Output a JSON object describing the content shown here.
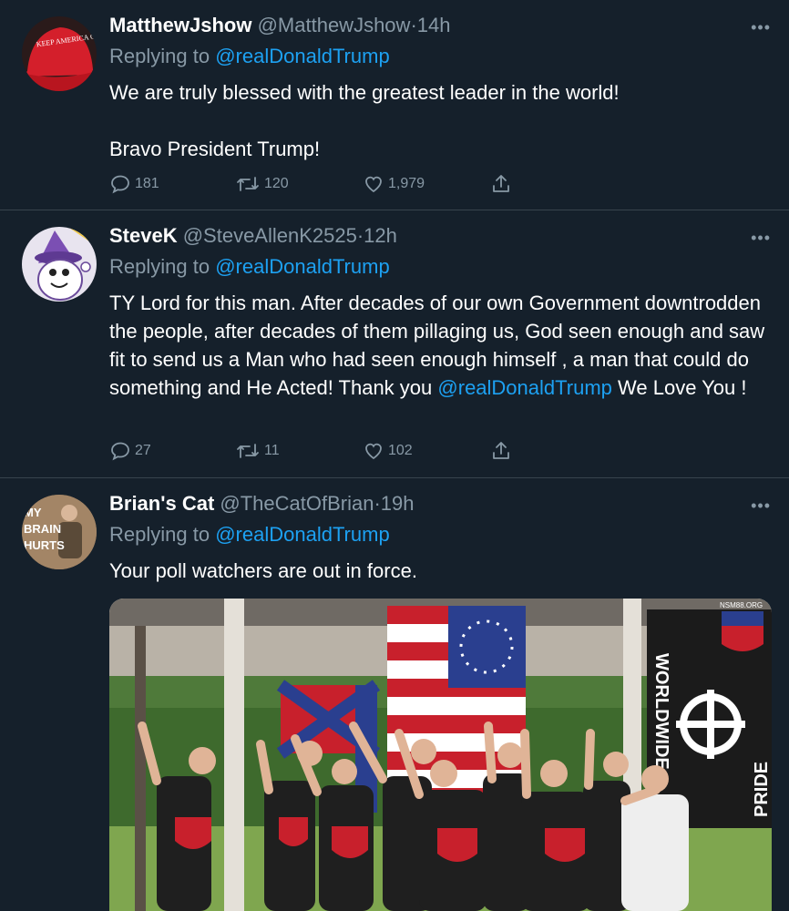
{
  "tweets": [
    {
      "name": "MatthewJshow",
      "handle": "@MatthewJshow",
      "dot": "·",
      "time": "14h",
      "replying_prefix": "Replying to",
      "replying_to": "@realDonaldTrump",
      "text_line1": "We are truly blessed with the greatest leader in the world!",
      "text_line2": "Bravo President Trump!",
      "replies": "181",
      "retweets": "120",
      "likes": "1,979",
      "avatar_text": "KEEP AMERICA GREAT"
    },
    {
      "name": "SteveK",
      "handle": "@SteveAllenK2525",
      "dot": "·",
      "time": "12h",
      "replying_prefix": "Replying to",
      "replying_to": "@realDonaldTrump",
      "text": "TY Lord for this man. After decades of our own Government downtrodden the people, after decades of them pillaging us, God seen enough and saw fit to send us a Man who had seen enough himself , a man that could do something and He Acted! Thank you",
      "text_mention": "@realDonaldTrump",
      "text_end": " We Love You !",
      "replies": "27",
      "retweets": "11",
      "likes": "102"
    },
    {
      "name": "Brian's Cat",
      "handle": "@TheCatOfBrian",
      "dot": "·",
      "time": "19h",
      "replying_prefix": "Replying to",
      "replying_to": "@realDonaldTrump",
      "text": "Your poll watchers are out in force.",
      "avatar_text_1": "MY",
      "avatar_text_2": "BRAIN",
      "avatar_text_3": "HURTS",
      "media_text_banner": "WORLDWIDE",
      "media_text_pride": "PRIDE",
      "media_text_corner": "NSM88.ORG"
    }
  ],
  "icons": {
    "more": "more-icon",
    "reply": "reply-icon",
    "retweet": "retweet-icon",
    "like": "heart-icon",
    "share": "share-icon"
  },
  "colors": {
    "background": "#15202b",
    "secondary_text": "#8899a6",
    "link": "#1da1f2",
    "divider": "#38444d"
  }
}
